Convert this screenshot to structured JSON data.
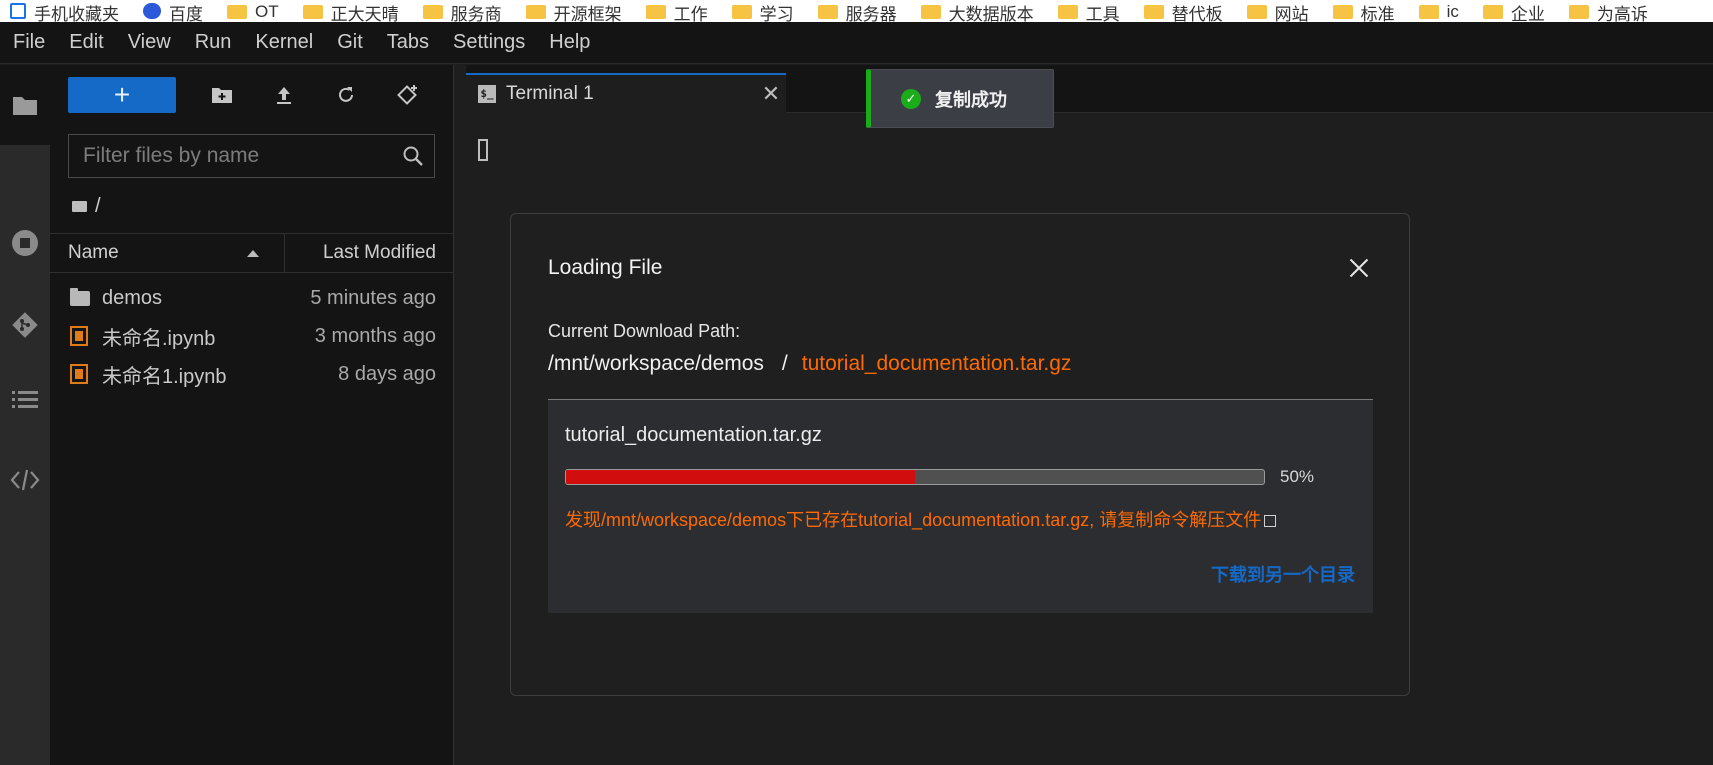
{
  "bookmarks": [
    {
      "icon": "page-icon",
      "label": "手机收藏夹"
    },
    {
      "icon": "paw-icon",
      "label": "百度"
    },
    {
      "icon": "folder-icon",
      "label": "OT"
    },
    {
      "icon": "folder-icon",
      "label": "正大天晴"
    },
    {
      "icon": "folder-icon",
      "label": "服务商"
    },
    {
      "icon": "folder-icon",
      "label": "开源框架"
    },
    {
      "icon": "folder-icon",
      "label": "工作"
    },
    {
      "icon": "folder-icon",
      "label": "学习"
    },
    {
      "icon": "folder-icon",
      "label": "服务器"
    },
    {
      "icon": "folder-icon",
      "label": "大数据版本"
    },
    {
      "icon": "folder-icon",
      "label": "工具"
    },
    {
      "icon": "folder-icon",
      "label": "替代板"
    },
    {
      "icon": "folder-icon",
      "label": "网站"
    },
    {
      "icon": "folder-icon",
      "label": "标准"
    },
    {
      "icon": "folder-icon",
      "label": "ic"
    },
    {
      "icon": "folder-icon",
      "label": "企业"
    },
    {
      "icon": "folder-icon",
      "label": "为高诉"
    }
  ],
  "menu": [
    "File",
    "Edit",
    "View",
    "Run",
    "Kernel",
    "Git",
    "Tabs",
    "Settings",
    "Help"
  ],
  "activity_icons": [
    "folder-icon",
    "stop-circle-icon",
    "git-icon",
    "list-icon",
    "code-icon"
  ],
  "filebrowser": {
    "new_label": "+",
    "filter_placeholder": "Filter files by name",
    "breadcrumb": "/",
    "col_name": "Name",
    "col_modified": "Last Modified",
    "files": [
      {
        "type": "folder",
        "name": "demos",
        "modified": "5 minutes ago"
      },
      {
        "type": "notebook",
        "name": "未命名.ipynb",
        "modified": "3 months ago"
      },
      {
        "type": "notebook",
        "name": "未命名1.ipynb",
        "modified": "8 days ago"
      }
    ]
  },
  "tabs": {
    "terminal_icon": "$_",
    "terminal_label": "Terminal 1"
  },
  "toast": {
    "message": "复制成功",
    "check": "✓"
  },
  "dialog": {
    "title": "Loading File",
    "path_label": "Current Download Path:",
    "path_dir": "/mnt/workspace/demos",
    "path_sep": "/",
    "path_file": "tutorial_documentation.tar.gz",
    "panel_file": "tutorial_documentation.tar.gz",
    "progress": 0.5,
    "progress_text": "50%",
    "warning": "发现/mnt/workspace/demos下已存在tutorial_documentation.tar.gz, 请复制命令解压文件",
    "alt_download": "下载到另一个目录"
  },
  "colors": {
    "accent": "#1569c7",
    "progress_fill": "#d10d0d",
    "warning": "#ff6a00",
    "success": "#1aad19"
  }
}
